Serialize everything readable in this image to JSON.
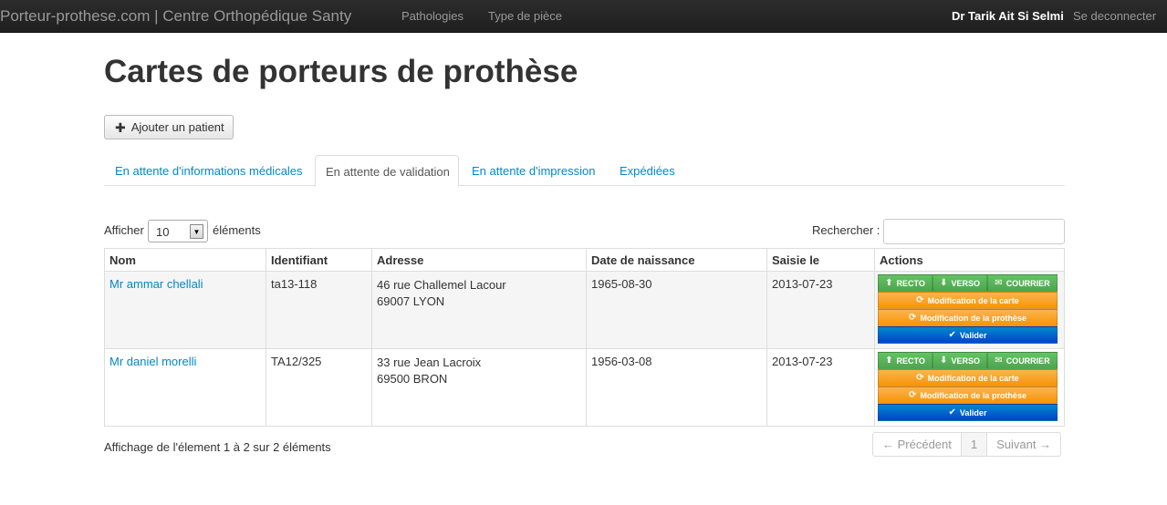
{
  "navbar": {
    "brand": "Porteur-prothese.com | Centre Orthopédique Santy",
    "links": [
      "Pathologies",
      "Type de pièce"
    ],
    "user": "Dr Tarik Ait Si Selmi",
    "logout": "Se deconnecter"
  },
  "page": {
    "title": "Cartes de porteurs de prothèse",
    "add_button": "Ajouter un patient"
  },
  "tabs": [
    {
      "label": "En attente d'informations médicales",
      "active": false
    },
    {
      "label": "En attente de validation",
      "active": true
    },
    {
      "label": "En attente d'impression",
      "active": false
    },
    {
      "label": "Expédiées",
      "active": false
    }
  ],
  "controls": {
    "show_label": "Afficher",
    "page_size": "10",
    "elements_label": "éléments",
    "search_label": "Rechercher :",
    "search_value": ""
  },
  "table": {
    "headers": [
      "Nom",
      "Identifiant",
      "Adresse",
      "Date de naissance",
      "Saisie le",
      "Actions"
    ],
    "rows": [
      {
        "name": "Mr ammar chellali",
        "id": "ta13-118",
        "address1": "46 rue Challemel Lacour",
        "address2": "69007 LYON",
        "birth": "1965-08-30",
        "entered": "2013-07-23"
      },
      {
        "name": "Mr daniel morelli",
        "id": "TA12/325",
        "address1": "33 rue Jean Lacroix",
        "address2": "69500 BRON",
        "birth": "1956-03-08",
        "entered": "2013-07-23"
      }
    ],
    "actions": {
      "recto": "RECTO",
      "verso": "VERSO",
      "courrier": "COURRIER",
      "modif_carte": "Modification de la carte",
      "modif_prothese": "Modification de la prothèse",
      "valider": "Valider"
    }
  },
  "footer": {
    "info": "Affichage de l'élement 1 à 2 sur 2 éléments",
    "prev": "← Précédent",
    "page": "1",
    "next": "Suivant →"
  },
  "colors": {
    "navbar": "#222222",
    "link": "#0088cc",
    "success": "#51a351",
    "warning": "#f89406",
    "primary": "#0044cc"
  }
}
